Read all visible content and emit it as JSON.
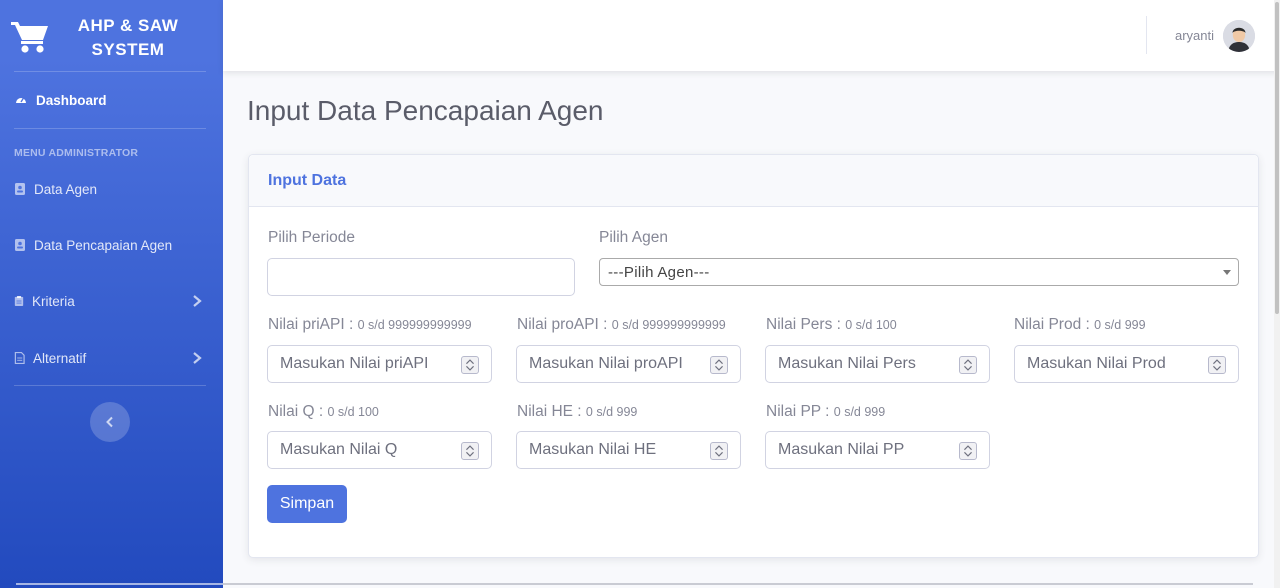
{
  "brand": {
    "line1": "AHP & SAW",
    "line2": "SYSTEM",
    "icon": "shopping-cart-icon"
  },
  "sidebar": {
    "dashboard": "Dashboard",
    "heading": "MENU ADMINISTRATOR",
    "items": [
      {
        "label": "Data Agen",
        "icon": "address-book-icon"
      },
      {
        "label": "Data Pencapaian Agen",
        "icon": "address-book-icon"
      },
      {
        "label": "Kriteria",
        "icon": "clipboard-icon",
        "has_submenu": true
      },
      {
        "label": "Alternatif",
        "icon": "file-icon",
        "has_submenu": true
      }
    ]
  },
  "topbar": {
    "user_name": "aryanti"
  },
  "page": {
    "title": "Input Data Pencapaian Agen"
  },
  "card": {
    "header": "Input Data"
  },
  "form": {
    "periode_label": "Pilih Periode",
    "periode_value": "",
    "agen_label": "Pilih Agen",
    "agen_selected": "---Pilih Agen---",
    "fields": [
      {
        "label": "Nilai priAPI :",
        "range": "0 s/d 999999999999",
        "placeholder": "Masukan Nilai priAPI"
      },
      {
        "label": "Nilai proAPI :",
        "range": "0 s/d 999999999999",
        "placeholder": "Masukan Nilai proAPI"
      },
      {
        "label": "Nilai Pers :",
        "range": "0 s/d 100",
        "placeholder": "Masukan Nilai Pers"
      },
      {
        "label": "Nilai Prod :",
        "range": "0 s/d 999",
        "placeholder": "Masukan Nilai Prod"
      },
      {
        "label": "Nilai Q :",
        "range": "0 s/d 100",
        "placeholder": "Masukan Nilai Q"
      },
      {
        "label": "Nilai HE :",
        "range": "0 s/d 999",
        "placeholder": "Masukan Nilai HE"
      },
      {
        "label": "Nilai PP :",
        "range": "0 s/d 999",
        "placeholder": "Masukan Nilai PP"
      }
    ],
    "submit_label": "Simpan"
  },
  "colors": {
    "primary": "#4e73df",
    "sidebar_end": "#224abe",
    "text_muted": "#858796"
  }
}
